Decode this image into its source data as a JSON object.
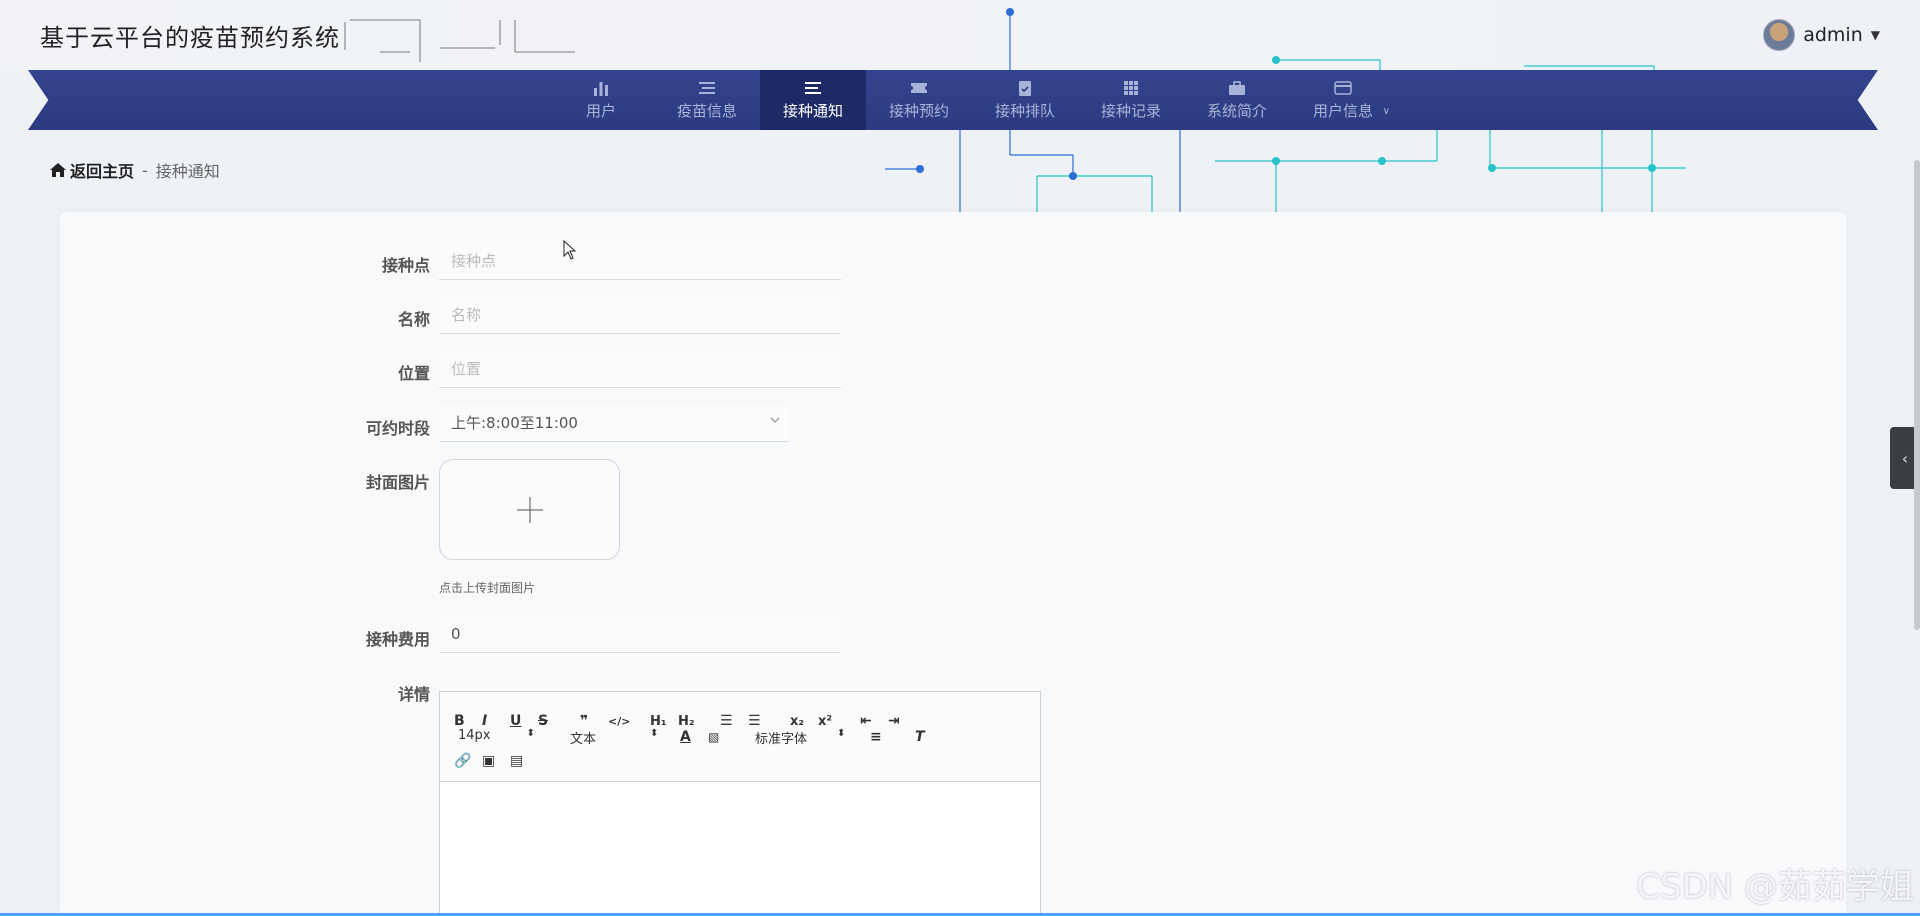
{
  "header": {
    "site_title": "基于云平台的疫苗预约系统",
    "user_name": "admin"
  },
  "nav": {
    "items": [
      {
        "label": "用户",
        "icon": "bar-chart-icon"
      },
      {
        "label": "疫苗信息",
        "icon": "list-icon"
      },
      {
        "label": "接种通知",
        "icon": "list-icon",
        "active": true
      },
      {
        "label": "接种预约",
        "icon": "ticket-icon"
      },
      {
        "label": "接种排队",
        "icon": "clipboard-check-icon"
      },
      {
        "label": "接种记录",
        "icon": "grid-icon"
      },
      {
        "label": "系统简介",
        "icon": "briefcase-icon"
      },
      {
        "label": "用户信息",
        "icon": "card-icon",
        "has_dropdown": true
      }
    ]
  },
  "breadcrumb": {
    "home": "返回主页",
    "separator": "-",
    "current": "接种通知"
  },
  "form": {
    "site": {
      "label": "接种点",
      "placeholder": "接种点"
    },
    "name": {
      "label": "名称",
      "placeholder": "名称"
    },
    "location": {
      "label": "位置",
      "placeholder": "位置"
    },
    "time_slot": {
      "label": "可约时段",
      "value": "上午:8:00至11:00"
    },
    "cover": {
      "label": "封面图片",
      "hint": "点击上传封面图片"
    },
    "fee": {
      "label": "接种费用",
      "value": "0"
    },
    "details": {
      "label": "详情"
    }
  },
  "editor": {
    "font_size": "14px",
    "text_style": "文本",
    "font_family": "标准字体"
  },
  "watermark": "CSDN @茹茹学姐",
  "colors": {
    "nav_bg": "#2c3b80",
    "nav_active": "#1e2a66",
    "accent": "#4aa3ff"
  }
}
